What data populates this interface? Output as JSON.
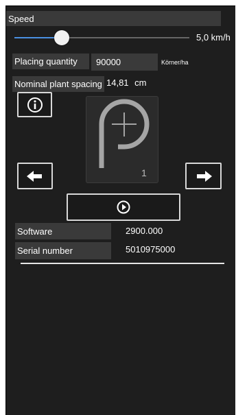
{
  "speed": {
    "label": "Speed",
    "value_text": "5,0 km/h",
    "slider_fraction": 0.28
  },
  "placing": {
    "label": "Placing quantity",
    "value": "90000",
    "unit": "Körner/ha"
  },
  "spacing": {
    "label": "Nominal plant spacing",
    "value": "14,81",
    "unit": "cm"
  },
  "logo": {
    "number": "1"
  },
  "info": [
    {
      "label": "Software",
      "value": "2900.000"
    },
    {
      "label": "Serial number",
      "value": "5010975000"
    }
  ],
  "icons": {
    "info": "info-circle-icon",
    "left": "arrow-left-icon",
    "right": "arrow-right-icon",
    "play": "play-circle-icon"
  },
  "colors": {
    "background": "#1e1e1e",
    "label_bg": "#3a3a3a",
    "slider_active": "#4a90e2"
  }
}
